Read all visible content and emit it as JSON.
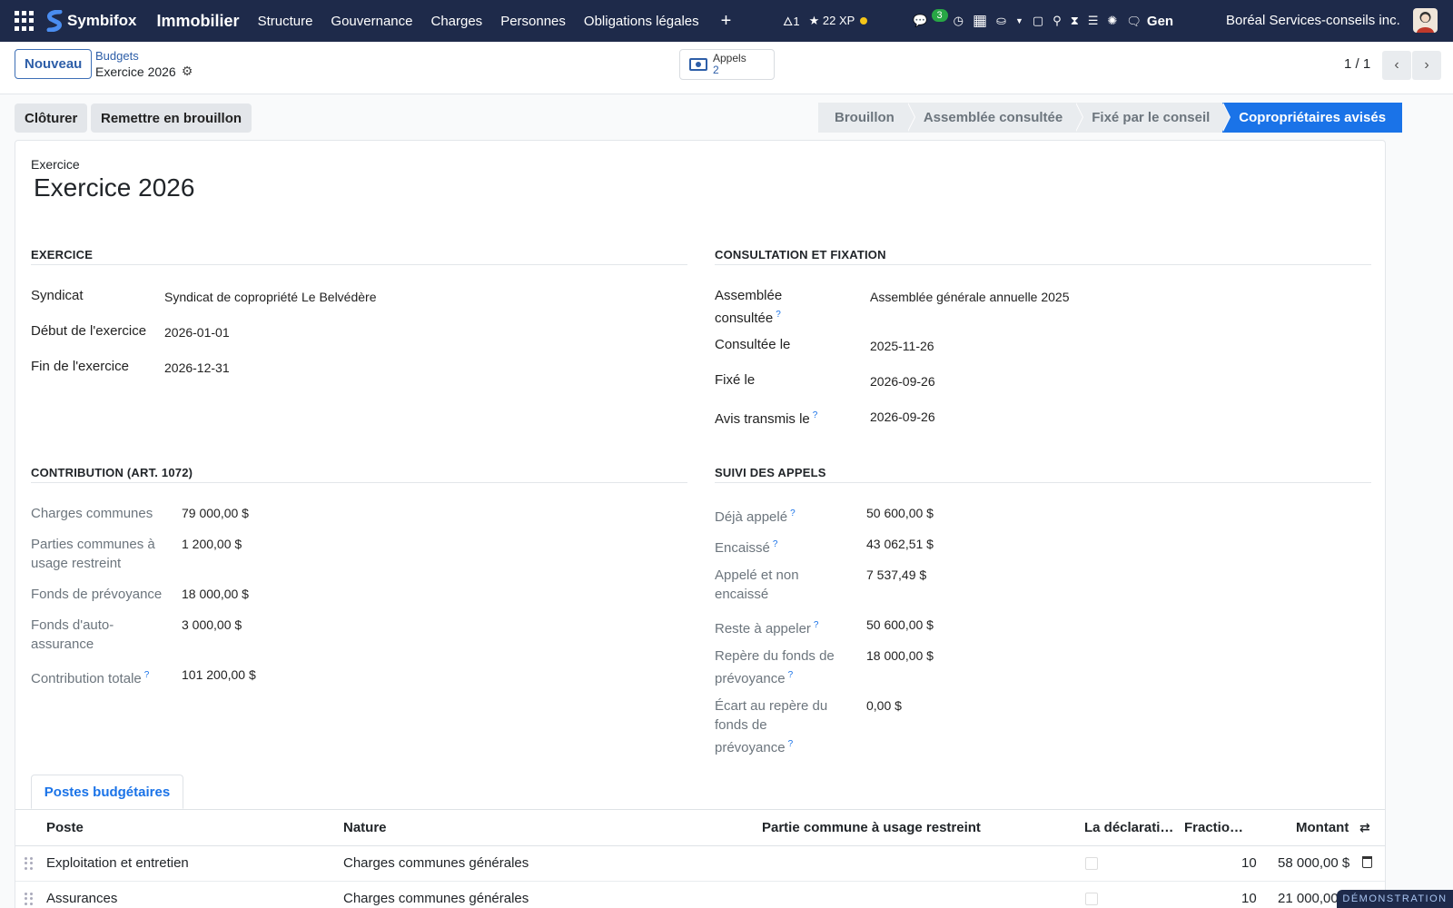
{
  "navbar": {
    "brand": "Symbifox",
    "app": "Immobilier",
    "menu": [
      "Structure",
      "Gouvernance",
      "Charges",
      "Personnes",
      "Obligations légales"
    ],
    "plus": "+",
    "systray": {
      "flame": "1",
      "xp": "22 XP",
      "chat_count": "3",
      "gen": "Gen"
    },
    "company": "Boréal Services-conseils inc."
  },
  "control": {
    "new_button": "Nouveau",
    "breadcrumb": "Budgets",
    "record_name": "Exercice 2026",
    "smart_button": {
      "label": "Appels",
      "count": "2"
    },
    "pager": "1 / 1"
  },
  "actions": {
    "close": "Clôturer",
    "reset": "Remettre en brouillon"
  },
  "stages": [
    {
      "label": "Brouillon",
      "active": false
    },
    {
      "label": "Assemblée consultée",
      "active": false
    },
    {
      "label": "Fixé par le conseil",
      "active": false
    },
    {
      "label": "Copropriétaires avisés",
      "active": true
    }
  ],
  "form": {
    "name_label": "Exercice",
    "name": "Exercice 2026",
    "exercice": {
      "title": "EXERCICE",
      "syndicat_label": "Syndicat",
      "syndicat": "Syndicat de copropriété Le Belvédère",
      "debut_label": "Début de l'exercice",
      "debut": "2026-01-01",
      "fin_label": "Fin de l'exercice",
      "fin": "2026-12-31"
    },
    "consultation": {
      "title": "CONSULTATION ET FIXATION",
      "assemblee_label_1": "Assemblée",
      "assemblee_label_2": "consultée",
      "assemblee": "Assemblée générale annuelle 2025",
      "consultee_label": "Consultée le",
      "consultee": "2025-11-26",
      "fixe_label": "Fixé le",
      "fixe": "2026-09-26",
      "avis_label": "Avis transmis le",
      "avis": "2026-09-26"
    },
    "contribution": {
      "title": "CONTRIBUTION (ART. 1072)",
      "charges_label": "Charges communes",
      "charges": "79 000,00 $",
      "parties_label_1": "Parties communes à",
      "parties_label_2": "usage restreint",
      "parties": "1 200,00 $",
      "prevoyance_label": "Fonds de prévoyance",
      "prevoyance": "18 000,00 $",
      "auto_label_1": "Fonds d'auto-",
      "auto_label_2": "assurance",
      "auto": "3 000,00 $",
      "totale_label": "Contribution totale",
      "totale": "101 200,00 $"
    },
    "suivi": {
      "title": "SUIVI DES APPELS",
      "deja_label": "Déjà appelé",
      "deja": "50 600,00 $",
      "encaisse_label": "Encaissé",
      "encaisse": "43 062,51 $",
      "non_enc_label_1": "Appelé et non",
      "non_enc_label_2": "encaissé",
      "non_enc": "7 537,49 $",
      "reste_label": "Reste à appeler",
      "reste": "50 600,00 $",
      "repere_label_1": "Repère du fonds de",
      "repere_label_2": "prévoyance",
      "repere": "18 000,00 $",
      "ecart_label_1": "Écart au repère du",
      "ecart_label_2": "fonds de",
      "ecart_label_3": "prévoyance",
      "ecart": "0,00 $"
    },
    "help_mark": "?"
  },
  "tabs": {
    "postes": "Postes budgétaires"
  },
  "table": {
    "columns": {
      "poste": "Poste",
      "nature": "Nature",
      "partie": "Partie commune à usage restreint",
      "declaration": "La déclarati…",
      "fraction": "Fractio…",
      "montant": "Montant"
    },
    "rows": [
      {
        "poste": "Exploitation et entretien",
        "nature": "Charges communes générales",
        "fraction": "10",
        "montant": "58 000,00 $"
      },
      {
        "poste": "Assurances",
        "nature": "Charges communes générales",
        "fraction": "10",
        "montant": "21 000,00 $"
      }
    ]
  },
  "demo_badge": "DÉMONSTRATION",
  "colors": {
    "navbar": "#1e2a4a",
    "accent": "#1a73e8"
  }
}
